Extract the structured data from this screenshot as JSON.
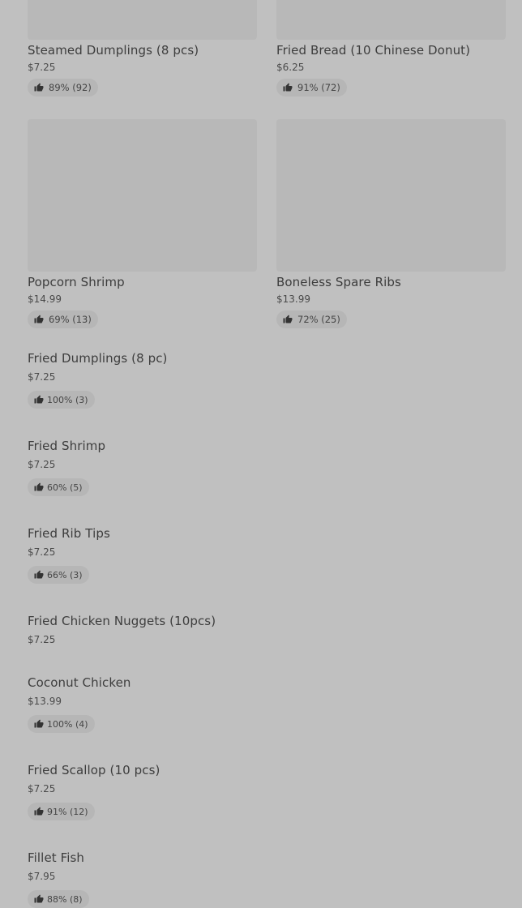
{
  "grid_items": [
    {
      "name": "Steamed Dumplings (8 pcs)",
      "price": "$7.25",
      "rating": "89% (92)"
    },
    {
      "name": "Fried Bread (10 Chinese Donut)",
      "price": "$6.25",
      "rating": "91% (72)"
    },
    {
      "name": "Popcorn Shrimp",
      "price": "$14.99",
      "rating": "69% (13)"
    },
    {
      "name": "Boneless Spare Ribs",
      "price": "$13.99",
      "rating": "72% (25)"
    }
  ],
  "list_items": [
    {
      "name": "Fried Dumplings (8 pc)",
      "price": "$7.25",
      "rating": "100% (3)"
    },
    {
      "name": "Fried Shrimp",
      "price": "$7.25",
      "rating": "60% (5)"
    },
    {
      "name": "Fried Rib Tips",
      "price": "$7.25",
      "rating": "66% (3)"
    },
    {
      "name": "Fried Chicken Nuggets (10pcs)",
      "price": "$7.25",
      "rating": ""
    },
    {
      "name": "Coconut Chicken",
      "price": "$13.99",
      "rating": "100% (4)"
    },
    {
      "name": "Fried Scallop (10 pcs)",
      "price": "$7.25",
      "rating": "91% (12)"
    },
    {
      "name": "Fillet Fish",
      "price": "$7.95",
      "rating": "88% (8)"
    }
  ]
}
